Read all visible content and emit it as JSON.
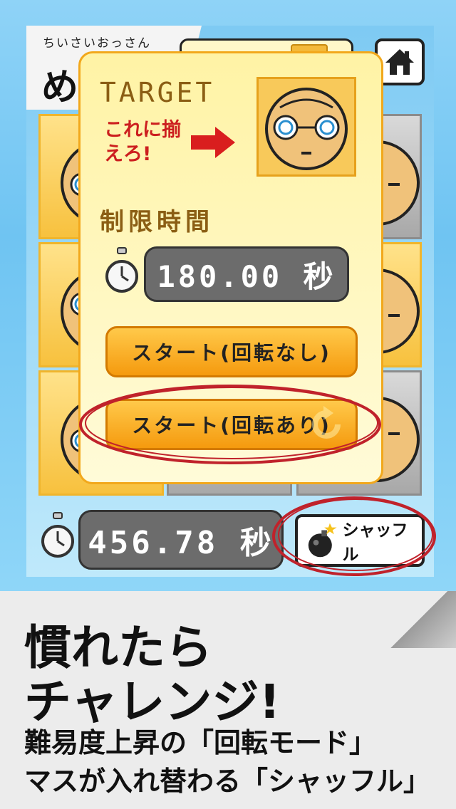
{
  "app": {
    "title_small": "ちいさいおっさん",
    "title_big": "め"
  },
  "modal": {
    "target_label": "TARGET",
    "hint_label": "これに揃えろ!",
    "time_limit_label": "制限時間",
    "time_value": "180.00 秒",
    "start_no_rotation": "スタート(回転なし)",
    "start_with_rotation": "スタート(回転あり)"
  },
  "game": {
    "timer_value": "456.78 秒",
    "shuffle_label": "シャッフル"
  },
  "caption": {
    "line1": "慣れたら",
    "line2": "チャレンジ!",
    "line3": "難易度上昇の「回転モード」",
    "line4": "マスが入れ替わる「シャッフル」"
  },
  "colors": {
    "sky": "#7ecaf3",
    "modal_border": "#f2a81c",
    "button_orange": "#f59a0e",
    "annotation_red": "#c0222b"
  },
  "icons": [
    "home-icon",
    "stopwatch-icon",
    "bomb-icon",
    "arrow-right-icon",
    "rotate-icon"
  ]
}
